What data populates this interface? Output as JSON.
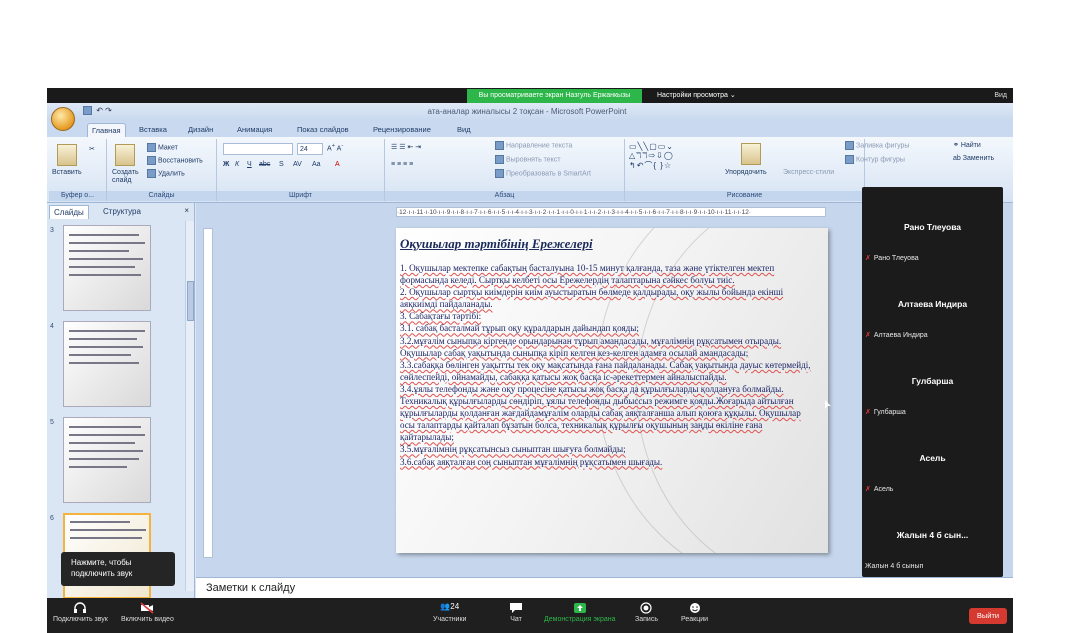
{
  "share_bar": {
    "viewing_label": "Вы просматриваете экран Назгуль Ержанкызы",
    "view_options": "Настройки просмотра ⌄",
    "view_btn": "Вид"
  },
  "powerpoint": {
    "window_title": "ата-аналар жиналысы 2 тоқсан - Microsoft PowerPoint",
    "tabs": [
      "Главная",
      "Вставка",
      "Дизайн",
      "Анимация",
      "Показ слайдов",
      "Рецензирование",
      "Вид"
    ],
    "ribbon": {
      "groups": [
        "Буфер о...",
        "Слайды",
        "Шрифт",
        "Абзац",
        "Рисование"
      ],
      "paste": "Вставить",
      "create_slide": "Создать слайд",
      "layout": "Макет",
      "restore": "Восстановить",
      "delete": "Удалить",
      "font_size": "24",
      "text_direction": "Направление текста",
      "align_text": "Выровнять текст",
      "smartart": "Преобразовать в SmartArt",
      "arrange": "Упорядочить",
      "quick_styles": "Экспресс-стили",
      "fill": "Заливка фигуры",
      "outline": "Контур фигуры",
      "find": "Найти",
      "replace": "Заменить"
    },
    "left_pane": {
      "tab_slides": "Слайды",
      "tab_structure": "Структура",
      "close": "×",
      "thumb_numbers": [
        "3",
        "4",
        "5",
        "6"
      ]
    },
    "ruler_text": "·12·ı·ı·11·ı·10·ı·ı·9·ı·ı·8·ı·ı·7·ı·ı·6·ı·ı·5·ı·ı·4·ı·ı·3·ı·ı·2·ı·ı·1·ı·ı·0·ı·ı·1·ı·ı·2·ı·ı·3·ı·ı·4·ı·ı·5·ı·ı·6·ı·ı·7·ı·ı·8·ı·ı·9·ı·ı·10·ı·ı·11·ı·ı·12·",
    "slide": {
      "title": "Оқушылар тәртібінің Ережелері",
      "paragraphs": [
        "1.  Оқушылар мектепке сабақтың басталуына 10-15 минут қалғанда, таза және үтіктелген мектеп формасында келеді. Сыртқы келбеті осы Ережелердің талаптарына сәйкес болуы тиіс.",
        "2.  Оқушылар сыртқы киімдерін киім ауыстыратын бөлмеде қалдырады, оқу жылы бойында екінші аяқкиімді пайдаланады.",
        "3.  Сабақтағы тәртібі:",
        "3.1. сабақ басталмай тұрып  оқу құралдарын дайындап қояды;",
        "3.2.мұғалім сыныпқа кіргенде орындарынан тұрып амандасады, мұғалімнің рұқсатымен отырады. Оқушылар сабақ уақытында сыныпқа кіріп келген кез-келген адамға осылай амандасады;",
        "3.3.сабаққа бөлінген уақытты тек оқу мақсатында ғана пайдаланады. Сабақ уақытында дауыс көтермейді, сөйлеспейді, ойнамайды, сабаққа қатысы жоқ басқа іс-әрекеттермен айналыспайды.",
        "3.4.ұялы телефонды және оқу процесіне қатысы жоқ басқа да құрылғыларды қолдануға болмайды. Техникалық құрылғыларды сөндіріп, ұялы телефонды дыбыссыз режимге қояды.Жоғарыда айтылған құрылғыларды қолданған жағдайдамұғалім оларды сабақ аяқталғанша алып қоюға құқылы. Оқушылар осы талаптарды қайталап бұзатын болса, техникалық құрылғы оқушының заңды өкіліне ғана қайтарылады;",
        "3.5.мұғалімнің рұқсатынсыз сыныптан шығуға болмайды;",
        "3.6.сабақ аяқталған соң сыныптан мұғалімнің рұқсатымен шығады."
      ]
    },
    "notes_placeholder": "Заметки к слайду"
  },
  "participants": [
    {
      "name": "Рано Тлеуова",
      "sub": "Рано Тлеуова"
    },
    {
      "name": "Алтаева Индира",
      "sub": "Алтаева Индира"
    },
    {
      "name": "Гулбарша",
      "sub": "Гулбарша"
    },
    {
      "name": "Асель",
      "sub": "Асель"
    },
    {
      "name": "Жалын 4 б сын...",
      "sub": "Жалын 4 б сынып"
    }
  ],
  "tooltip": "Нажмите, чтобы подключить звук",
  "toolbar": {
    "audio": "Подключить звук",
    "video": "Включить видео",
    "participants_count": "24",
    "participants": "Участники",
    "chat": "Чат",
    "share": "Демонстрация экрана",
    "record": "Запись",
    "reactions": "Реакции",
    "leave": "Выйти"
  },
  "colors": {
    "share_green": "#2db64a",
    "leave_red": "#d43a2f",
    "slide_text": "#1b2566"
  }
}
